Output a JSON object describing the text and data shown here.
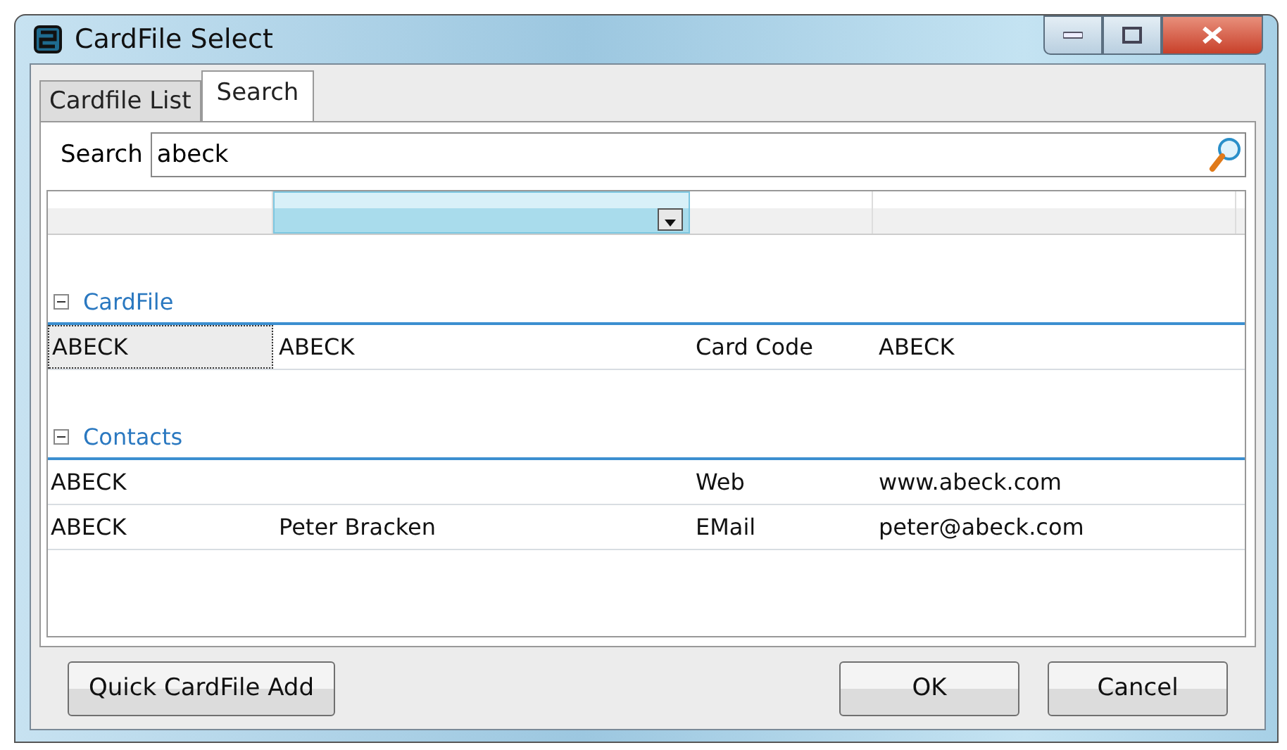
{
  "window": {
    "title": "CardFile Select"
  },
  "tabs": [
    {
      "label": "Cardfile List",
      "selected": false
    },
    {
      "label": "Search",
      "selected": true
    }
  ],
  "search": {
    "label": "Search",
    "value": "abeck"
  },
  "grid": {
    "columns": [
      {
        "highlighted": false
      },
      {
        "highlighted": true
      },
      {
        "highlighted": false
      },
      {
        "highlighted": false
      }
    ],
    "groups": [
      {
        "name": "CardFile",
        "expanded": true,
        "rows": [
          {
            "cells": [
              "ABECK",
              "ABECK",
              "Card Code",
              "ABECK"
            ],
            "selected": true
          }
        ]
      },
      {
        "name": "Contacts",
        "expanded": true,
        "rows": [
          {
            "cells": [
              "ABECK",
              "",
              "Web",
              "www.abeck.com"
            ],
            "selected": false
          },
          {
            "cells": [
              "ABECK",
              "Peter Bracken",
              "EMail",
              "peter@abeck.com"
            ],
            "selected": false
          }
        ]
      }
    ]
  },
  "buttons": [
    {
      "label": "Quick CardFile Add",
      "kind": "left"
    },
    {
      "label": "OK",
      "kind": "right"
    },
    {
      "label": "Cancel",
      "kind": "right"
    }
  ]
}
